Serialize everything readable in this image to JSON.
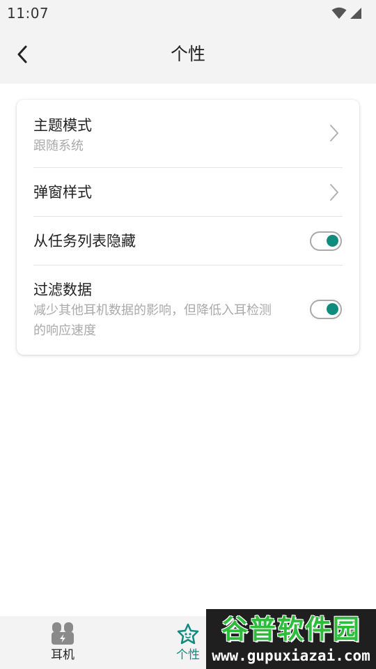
{
  "status_bar": {
    "time": "11:07",
    "icons": [
      "wifi-icon",
      "cell-signal-icon"
    ]
  },
  "header": {
    "title": "个性",
    "back_icon": "chevron-left-icon"
  },
  "settings": {
    "theme_mode": {
      "title": "主题模式",
      "subtitle": "跟随系统"
    },
    "popup_style": {
      "title": "弹窗样式"
    },
    "hide_from_tasks": {
      "title": "从任务列表隐藏",
      "enabled": true
    },
    "filter_data": {
      "title": "过滤数据",
      "subtitle_line1": "减少其他耳机数据的影响，但降低入耳检测",
      "subtitle_line2": "的响应速度",
      "enabled": true
    }
  },
  "bottom_nav": {
    "items": [
      {
        "label": "耳机",
        "icon": "earbuds-case-icon",
        "active": false
      },
      {
        "label": "个性",
        "icon": "star-face-icon",
        "active": true
      }
    ]
  },
  "watermark": {
    "title": "谷普软件园",
    "url": "www.gupuxiazai.com"
  },
  "colors": {
    "accent": "#0f8c7e",
    "header_bg": "#f2f3f2",
    "text_secondary": "#aaaaaa",
    "watermark_green": "#2dbd3a"
  }
}
